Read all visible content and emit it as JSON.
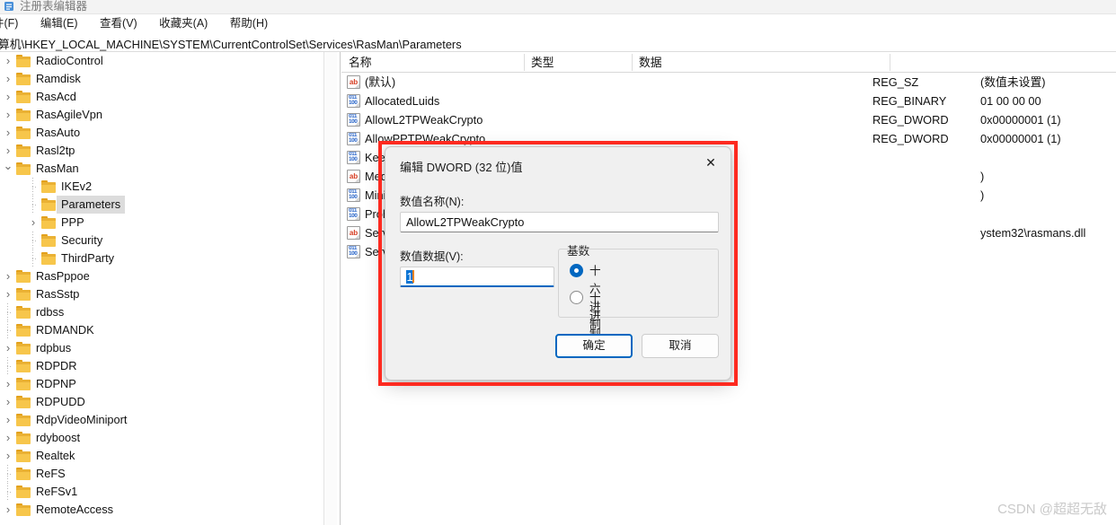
{
  "window": {
    "title": "注册表编辑器",
    "icon": "registry-icon"
  },
  "menubar": {
    "items": [
      {
        "label": "件(F)",
        "name": "menu-file"
      },
      {
        "label": "编辑(E)",
        "name": "menu-edit"
      },
      {
        "label": "查看(V)",
        "name": "menu-view"
      },
      {
        "label": "收藏夹(A)",
        "name": "menu-favorites"
      },
      {
        "label": "帮助(H)",
        "name": "menu-help"
      }
    ]
  },
  "address": {
    "path": "算机\\HKEY_LOCAL_MACHINE\\SYSTEM\\CurrentControlSet\\Services\\RasMan\\Parameters"
  },
  "tree": {
    "nodes": [
      {
        "label": "RadioControl",
        "indent": 0,
        "state": "collapsed",
        "selected": false
      },
      {
        "label": "Ramdisk",
        "indent": 0,
        "state": "collapsed",
        "selected": false
      },
      {
        "label": "RasAcd",
        "indent": 0,
        "state": "collapsed",
        "selected": false
      },
      {
        "label": "RasAgileVpn",
        "indent": 0,
        "state": "collapsed",
        "selected": false
      },
      {
        "label": "RasAuto",
        "indent": 0,
        "state": "collapsed",
        "selected": false
      },
      {
        "label": "Rasl2tp",
        "indent": 0,
        "state": "collapsed",
        "selected": false
      },
      {
        "label": "RasMan",
        "indent": 0,
        "state": "expanded",
        "selected": false
      },
      {
        "label": "IKEv2",
        "indent": 1,
        "state": "leaf",
        "selected": false
      },
      {
        "label": "Parameters",
        "indent": 1,
        "state": "leaf",
        "selected": true
      },
      {
        "label": "PPP",
        "indent": 1,
        "state": "collapsed",
        "selected": false
      },
      {
        "label": "Security",
        "indent": 1,
        "state": "leaf",
        "selected": false
      },
      {
        "label": "ThirdParty",
        "indent": 1,
        "state": "leaf",
        "selected": false
      },
      {
        "label": "RasPppoe",
        "indent": 0,
        "state": "collapsed",
        "selected": false
      },
      {
        "label": "RasSstp",
        "indent": 0,
        "state": "collapsed",
        "selected": false
      },
      {
        "label": "rdbss",
        "indent": 0,
        "state": "leaf",
        "selected": false
      },
      {
        "label": "RDMANDK",
        "indent": 0,
        "state": "leaf",
        "selected": false
      },
      {
        "label": "rdpbus",
        "indent": 0,
        "state": "collapsed",
        "selected": false
      },
      {
        "label": "RDPDR",
        "indent": 0,
        "state": "leaf",
        "selected": false
      },
      {
        "label": "RDPNP",
        "indent": 0,
        "state": "collapsed",
        "selected": false
      },
      {
        "label": "RDPUDD",
        "indent": 0,
        "state": "collapsed",
        "selected": false
      },
      {
        "label": "RdpVideoMiniport",
        "indent": 0,
        "state": "collapsed",
        "selected": false
      },
      {
        "label": "rdyboost",
        "indent": 0,
        "state": "collapsed",
        "selected": false
      },
      {
        "label": "Realtek",
        "indent": 0,
        "state": "collapsed",
        "selected": false
      },
      {
        "label": "ReFS",
        "indent": 0,
        "state": "leaf",
        "selected": false
      },
      {
        "label": "ReFSv1",
        "indent": 0,
        "state": "leaf",
        "selected": false
      },
      {
        "label": "RemoteAccess",
        "indent": 0,
        "state": "collapsed",
        "selected": false
      }
    ]
  },
  "list": {
    "columns": [
      {
        "label": "名称",
        "name": "column-name"
      },
      {
        "label": "类型",
        "name": "column-type"
      },
      {
        "label": "数据",
        "name": "column-data"
      }
    ],
    "rows": [
      {
        "icon": "sz",
        "name": "(默认)",
        "type": "REG_SZ",
        "data": "(数值未设置)"
      },
      {
        "icon": "bin",
        "name": "AllocatedLuids",
        "type": "REG_BINARY",
        "data": "01 00 00 00"
      },
      {
        "icon": "bin",
        "name": "AllowL2TPWeakCrypto",
        "type": "REG_DWORD",
        "data": "0x00000001 (1)"
      },
      {
        "icon": "bin",
        "name": "AllowPPTPWeakCrypto",
        "type": "REG_DWORD",
        "data": "0x00000001 (1)"
      },
      {
        "icon": "bin",
        "name": "Kee",
        "type": "",
        "data": ""
      },
      {
        "icon": "sz",
        "name": "Med",
        "type": "",
        "data": ")"
      },
      {
        "icon": "bin",
        "name": "Mini",
        "type": "",
        "data": ")"
      },
      {
        "icon": "bin",
        "name": "Proh",
        "type": "",
        "data": ""
      },
      {
        "icon": "sz",
        "name": "Serv",
        "type": "",
        "data": "ystem32\\rasmans.dll"
      },
      {
        "icon": "bin",
        "name": "Serv",
        "type": "",
        "data": ""
      }
    ]
  },
  "dialog": {
    "title": "编辑 DWORD (32 位)值",
    "close_label": "✕",
    "name_label": "数值名称(N):",
    "name_value": "AllowL2TPWeakCrypto",
    "data_label": "数值数据(V):",
    "data_value": "1",
    "base_group_label": "基数",
    "radios": [
      {
        "label": "十六进制(H)",
        "checked": true,
        "name": "radio-hexadecimal"
      },
      {
        "label": "十进制(D)",
        "checked": false,
        "name": "radio-decimal"
      }
    ],
    "ok_label": "确定",
    "cancel_label": "取消"
  },
  "watermark": {
    "text": "CSDN @超超无敌"
  },
  "colors": {
    "accent": "#0067c0",
    "annotation": "#fd2a20",
    "selection": "#0a74d4",
    "caret": "#e88218",
    "folder": "#f7c64b"
  }
}
